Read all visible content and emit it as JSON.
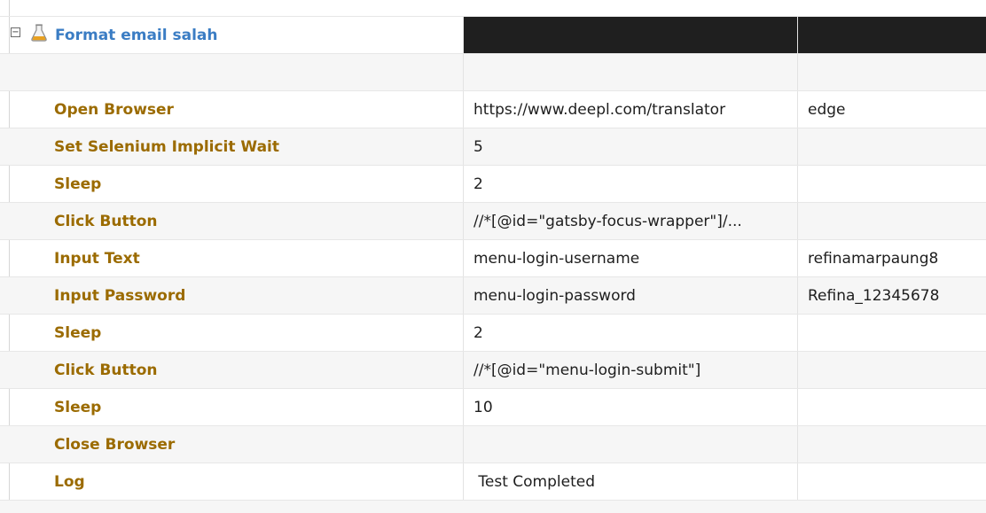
{
  "testcase": {
    "title": "Format email salah",
    "expander": "⊟"
  },
  "steps": [
    {
      "keyword": "Open Browser",
      "arg1": "https://www.deepl.com/translator",
      "arg2": "edge"
    },
    {
      "keyword": "Set Selenium Implicit Wait",
      "arg1": "5",
      "arg2": ""
    },
    {
      "keyword": "Sleep",
      "arg1": "2",
      "arg2": ""
    },
    {
      "keyword": "Click Button",
      "arg1": "//*[@id=\"gatsby-focus-wrapper\"]/...",
      "arg2": ""
    },
    {
      "keyword": "Input Text",
      "arg1": "menu-login-username",
      "arg2": "refinamarpaung8"
    },
    {
      "keyword": "Input Password",
      "arg1": "menu-login-password",
      "arg2": "Refina_12345678"
    },
    {
      "keyword": "Sleep",
      "arg1": "2",
      "arg2": ""
    },
    {
      "keyword": "Click Button",
      "arg1": "//*[@id=\"menu-login-submit\"]",
      "arg2": ""
    },
    {
      "keyword": "Sleep",
      "arg1": "10",
      "arg2": ""
    },
    {
      "keyword": "Close Browser",
      "arg1": "",
      "arg2": ""
    },
    {
      "keyword": "Log",
      "arg1": " Test Completed",
      "arg2": ""
    }
  ],
  "icons": {
    "expander": "collapse-icon",
    "testcase": "flask-icon"
  },
  "colors": {
    "keyword": "#9b6b00",
    "title": "#3b7dc4",
    "header_fill": "#1f1f1f"
  }
}
